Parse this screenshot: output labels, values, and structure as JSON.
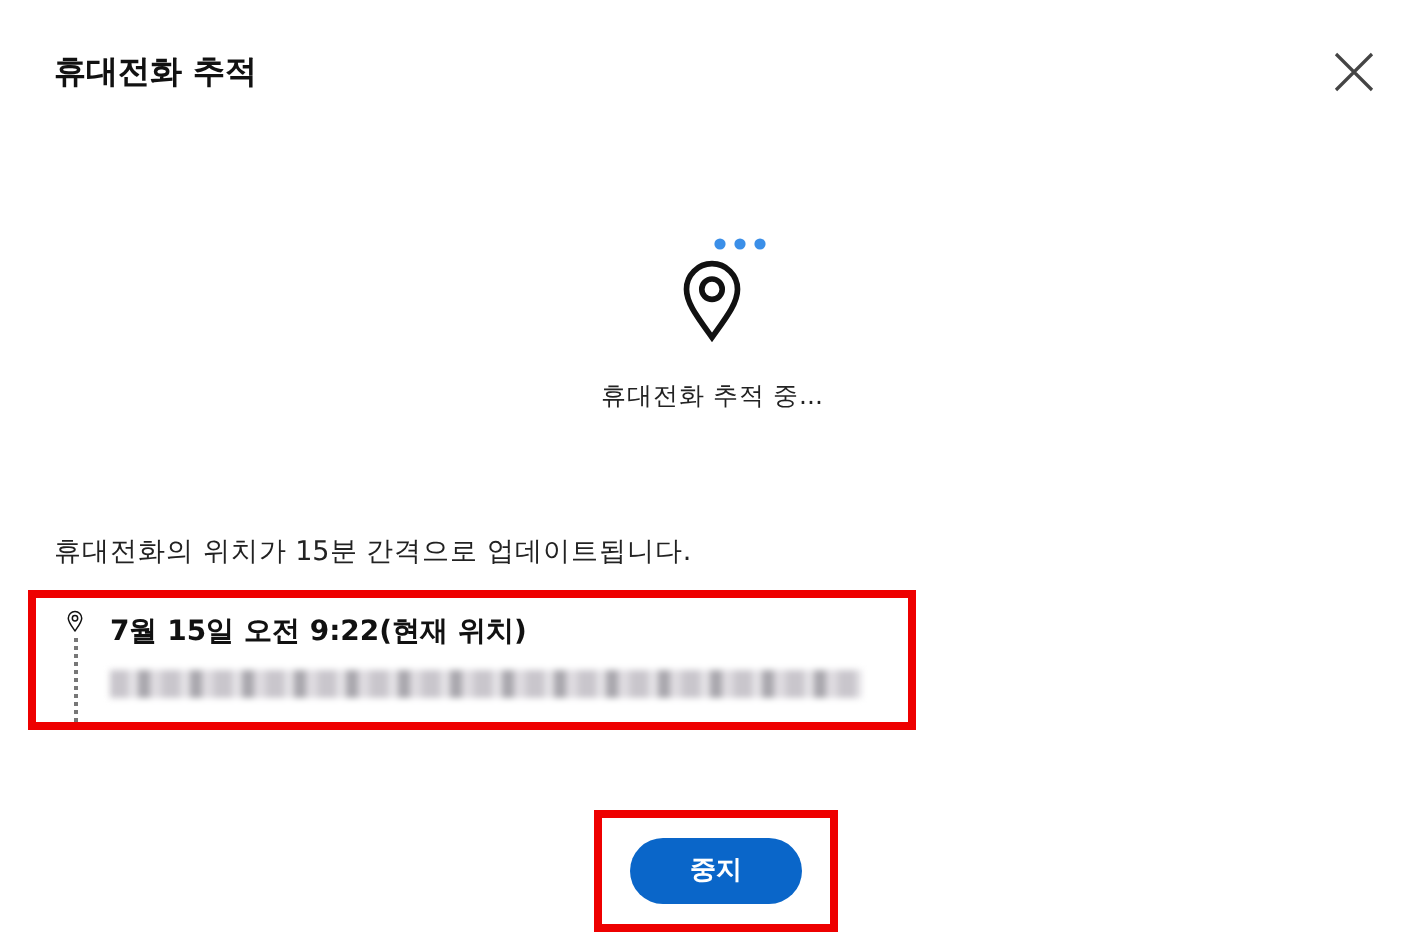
{
  "dialog": {
    "title": "휴대전화 추적"
  },
  "status": {
    "text": "휴대전화 추적 중...",
    "busy": true
  },
  "info": "휴대전화의 위치가 15분 간격으로 업데이트됩니다.",
  "locations": [
    {
      "time": "7월 15일 오전 9:22(현재 위치)",
      "highlighted": true
    }
  ],
  "stop_button": {
    "label": "중지",
    "highlighted": true
  }
}
